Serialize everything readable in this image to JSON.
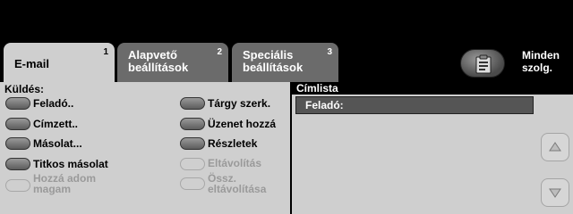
{
  "tabs": [
    {
      "label": "E-mail",
      "num": "1"
    },
    {
      "label": "Alapvető beállítások",
      "num": "2"
    },
    {
      "label": "Speciális beállítások",
      "num": "3"
    }
  ],
  "services": {
    "label": "Minden szolg.",
    "icon": "services-icon"
  },
  "left_panel": {
    "title": "Küldés:",
    "options": {
      "sender": "Feladó..",
      "recipient": "Címzett..",
      "copy": "Másolat...",
      "bcc": "Titkos másolat",
      "add_me": "Hozzá adom magam",
      "subject_edit": "Tárgy szerk.",
      "message_add": "Üzenet hozzá",
      "details": "Részletek",
      "remove": "Eltávolítás",
      "remove_all": "Össz. eltávolítása"
    }
  },
  "address_list": {
    "header": "Címlista",
    "rows": [
      "Feladó:"
    ]
  },
  "scroll": {
    "up_icon": "arrow-up-icon",
    "down_icon": "arrow-down-icon"
  }
}
